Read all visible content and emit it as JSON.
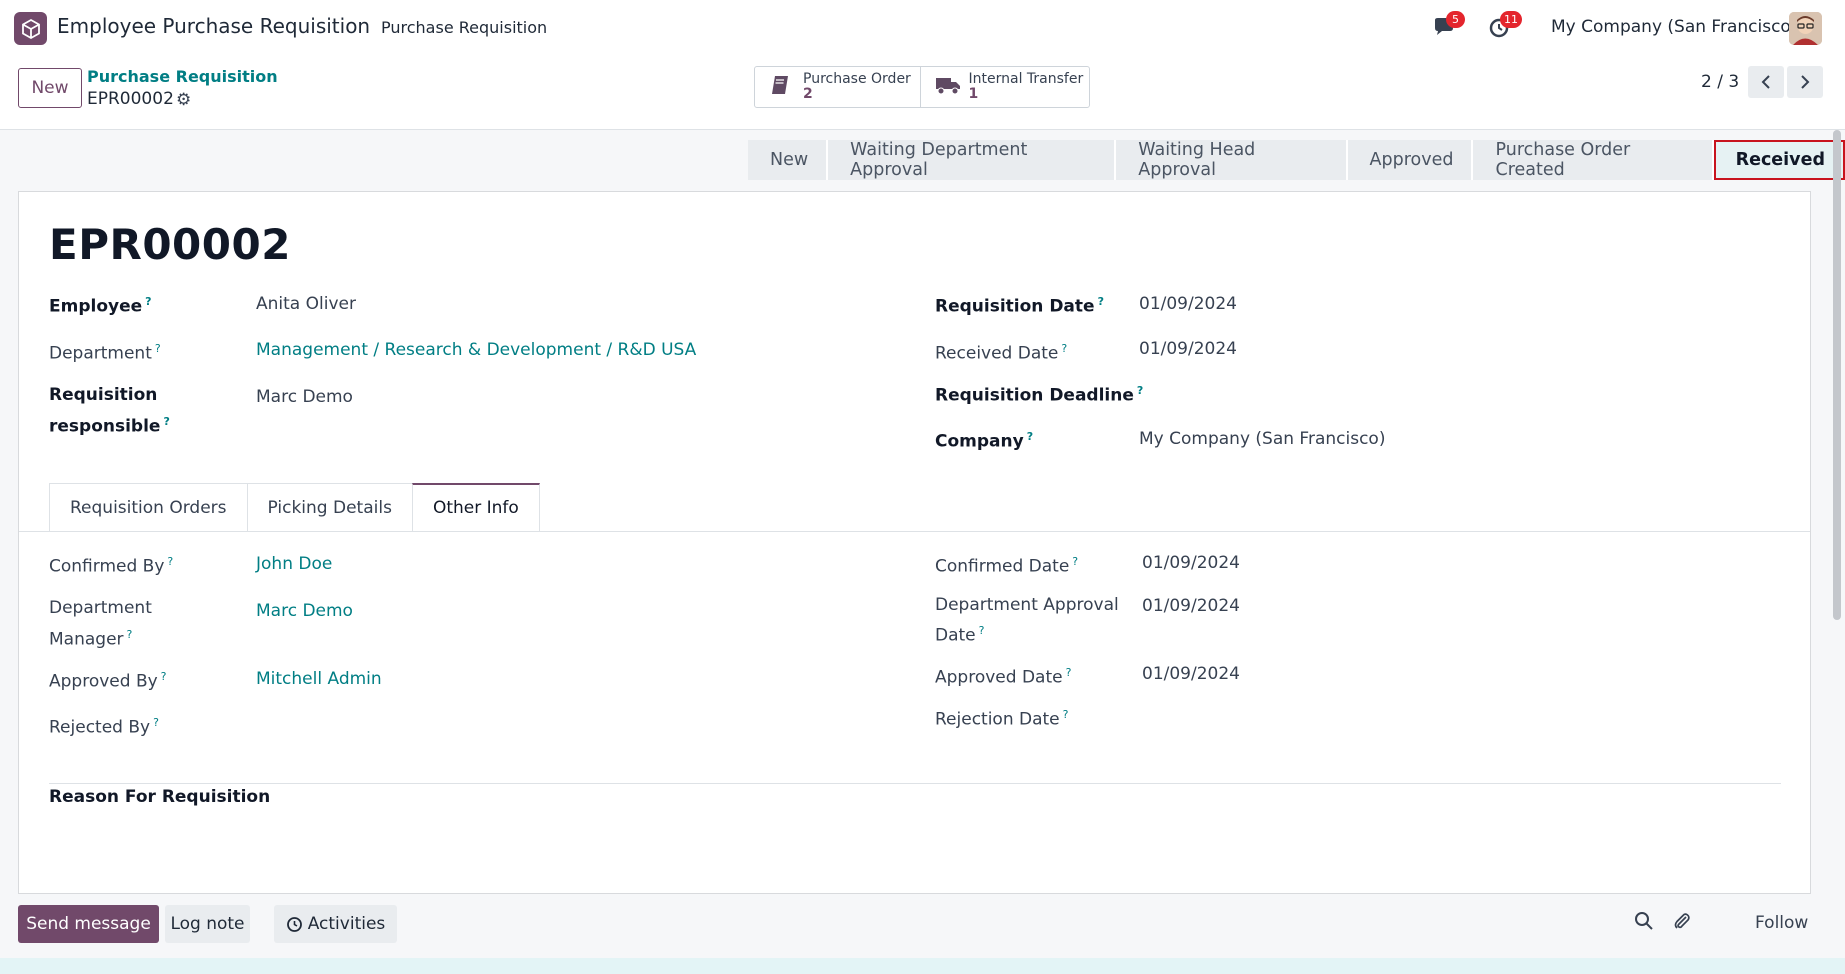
{
  "navbar": {
    "app_name": "Employee Purchase Requisition",
    "menu_item": "Purchase Requisition",
    "messages_badge": "5",
    "activities_badge": "11",
    "company": "My Company (San Francisco)"
  },
  "control": {
    "new_label": "New",
    "breadcrumb_parent": "Purchase Requisition",
    "breadcrumb_current": "EPR00002",
    "smart_buttons": [
      {
        "label": "Purchase Order",
        "value": "2",
        "icon": "book-icon"
      },
      {
        "label": "Internal Transfer",
        "value": "1",
        "icon": "truck-icon"
      }
    ],
    "pager": "2 / 3"
  },
  "statusbar": {
    "stages": [
      "New",
      "Waiting Department Approval",
      "Waiting Head Approval",
      "Approved",
      "Purchase Order Created",
      "Received"
    ],
    "active": "Received"
  },
  "record": {
    "title": "EPR00002",
    "employee_label": "Employee",
    "employee": "Anita Oliver",
    "department_label": "Department",
    "department": "Management / Research & Development / R&D USA",
    "responsible_label_1": "Requisition",
    "responsible_label_2": "responsible",
    "responsible": "Marc Demo",
    "req_date_label": "Requisition Date",
    "req_date": "01/09/2024",
    "received_date_label": "Received Date",
    "received_date": "01/09/2024",
    "deadline_label": "Requisition Deadline",
    "company_label": "Company",
    "company": "My Company (San Francisco)"
  },
  "tabs": [
    "Requisition Orders",
    "Picking Details",
    "Other Info"
  ],
  "other_info": {
    "confirmed_by_label": "Confirmed By",
    "confirmed_by": "John Doe",
    "dept_manager_label_1": "Department",
    "dept_manager_label_2": "Manager",
    "dept_manager": "Marc Demo",
    "approved_by_label": "Approved By",
    "approved_by": "Mitchell Admin",
    "rejected_by_label": "Rejected By",
    "confirmed_date_label": "Confirmed Date",
    "confirmed_date": "01/09/2024",
    "dept_approval_label_1": "Department Approval",
    "dept_approval_label_2": "Date",
    "dept_approval_date": "01/09/2024",
    "approved_date_label": "Approved Date",
    "approved_date": "01/09/2024",
    "rejection_date_label": "Rejection Date",
    "reason_label": "Reason For Requisition"
  },
  "chatter": {
    "send_message": "Send message",
    "log_note": "Log note",
    "activities": "Activities",
    "follow": "Follow"
  },
  "help_mark": "?"
}
